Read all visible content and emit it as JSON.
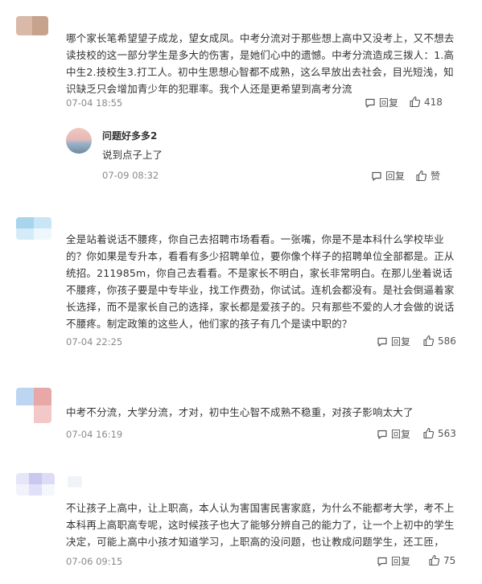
{
  "comments": [
    {
      "text": "哪个家长笔希望望子成龙，望女成凤。中考分流对于那些想上高中又没考上，又不想去读技校的这一部分学生是多大的伤害，是她们心中的遗憾。中考分流造成三拨人：1.高中生2.技校生3.打工人。初中生思想心智都不成熟，这么早放出去社会，目光短浅，知识缺乏只会增加青少年的犯罪率。我个人还是更希望到高考分流",
      "date": "07-04 18:55",
      "reply_label": "回复",
      "likes": "418",
      "reply": {
        "name": "问题好多多2",
        "text": "说到点子上了",
        "date": "07-09 08:32",
        "reply_label": "回复",
        "like_label": "赞"
      }
    },
    {
      "text": "全是站着说话不腰疼，你自己去招聘市场看看。一张嘴，你是不是本科什么学校毕业的？你如果是专升本，看看有多少招聘单位，要你像个样子的招聘单位全部都是。正从统招。211985m，你自己去看看。不是家长不明白，家长非常明白。在那儿坐着说话不腰疼，你孩子要是中专毕业，找工作费劲，你试试。连机会都没有。是社会倒逼着家长选择，而不是家长自己的选择，家长都是爱孩子的。只有那些不爱的人才会做的说话不腰疼。制定政策的这些人，他们家的孩子有几个是读中职的？",
      "date": "07-04 22:25",
      "reply_label": "回复",
      "likes": "586"
    },
    {
      "text": "中考不分流，大学分流，才对，初中生心智不成熟不稳重，对孩子影响太大了",
      "date": "07-04 16:19",
      "reply_label": "回复",
      "likes": "563"
    },
    {
      "text": "不让孩子上高中，让上职高，本人认为害国害民害家庭，为什么不能都考大学，考不上本科再上高职高专呢，这时候孩子也大了能够分辨自己的能力了，让一个上初中的学生决定，可能上高中小孩才知道学习，上职高的没问题，也让教成问题学生，还工匝，",
      "date": "07-06 09:15",
      "reply_label": "回复",
      "likes": "75"
    }
  ],
  "colors": {
    "text": "#333333",
    "meta": "#8a8a8a",
    "icon": "#555555"
  }
}
